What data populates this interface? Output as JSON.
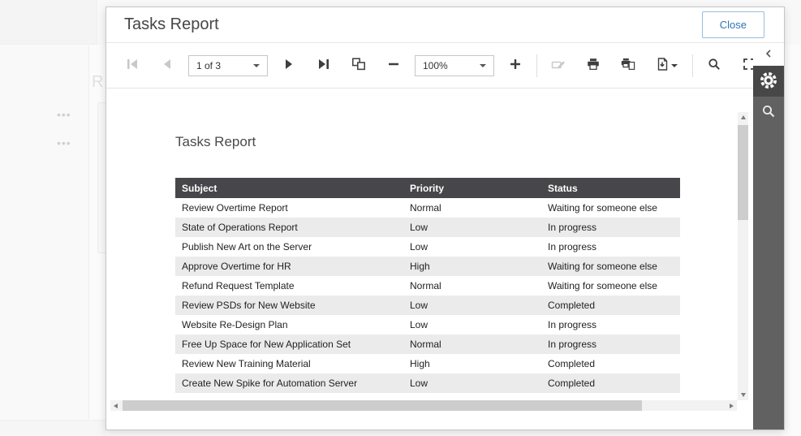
{
  "background": {
    "partial_heading": "R",
    "ellipsis": "•••"
  },
  "dialog": {
    "title": "Tasks Report",
    "close_label": "Close"
  },
  "toolbar": {
    "page_selector_value": "1 of 3",
    "zoom_value": "100%"
  },
  "document": {
    "title": "Tasks Report",
    "table": {
      "columns": [
        "Subject",
        "Priority",
        "Status"
      ],
      "rows": [
        [
          "Review Overtime Report",
          "Normal",
          "Waiting for someone else"
        ],
        [
          "State of Operations Report",
          "Low",
          "In progress"
        ],
        [
          "Publish New Art on the Server",
          "Low",
          "In progress"
        ],
        [
          "Approve Overtime for HR",
          "High",
          "Waiting for someone else"
        ],
        [
          "Refund Request Template",
          "Normal",
          "Waiting for someone else"
        ],
        [
          "Review PSDs for New Website",
          "Low",
          "Completed"
        ],
        [
          "Website Re-Design Plan",
          "Low",
          "In progress"
        ],
        [
          "Free Up Space for New Application Set",
          "Normal",
          "In progress"
        ],
        [
          "Review New Training Material",
          "High",
          "Completed"
        ],
        [
          "Create New Spike for Automation Server",
          "Low",
          "Completed"
        ]
      ]
    }
  },
  "colors": {
    "accent_blue": "#2e75b6",
    "table_header_bg": "#47464b",
    "row_alt_bg": "#ebebeb",
    "panel_bg": "#616161",
    "panel_active_bg": "#474747",
    "icon": "#3e3e3e",
    "icon_disabled": "#c9c9c9"
  }
}
